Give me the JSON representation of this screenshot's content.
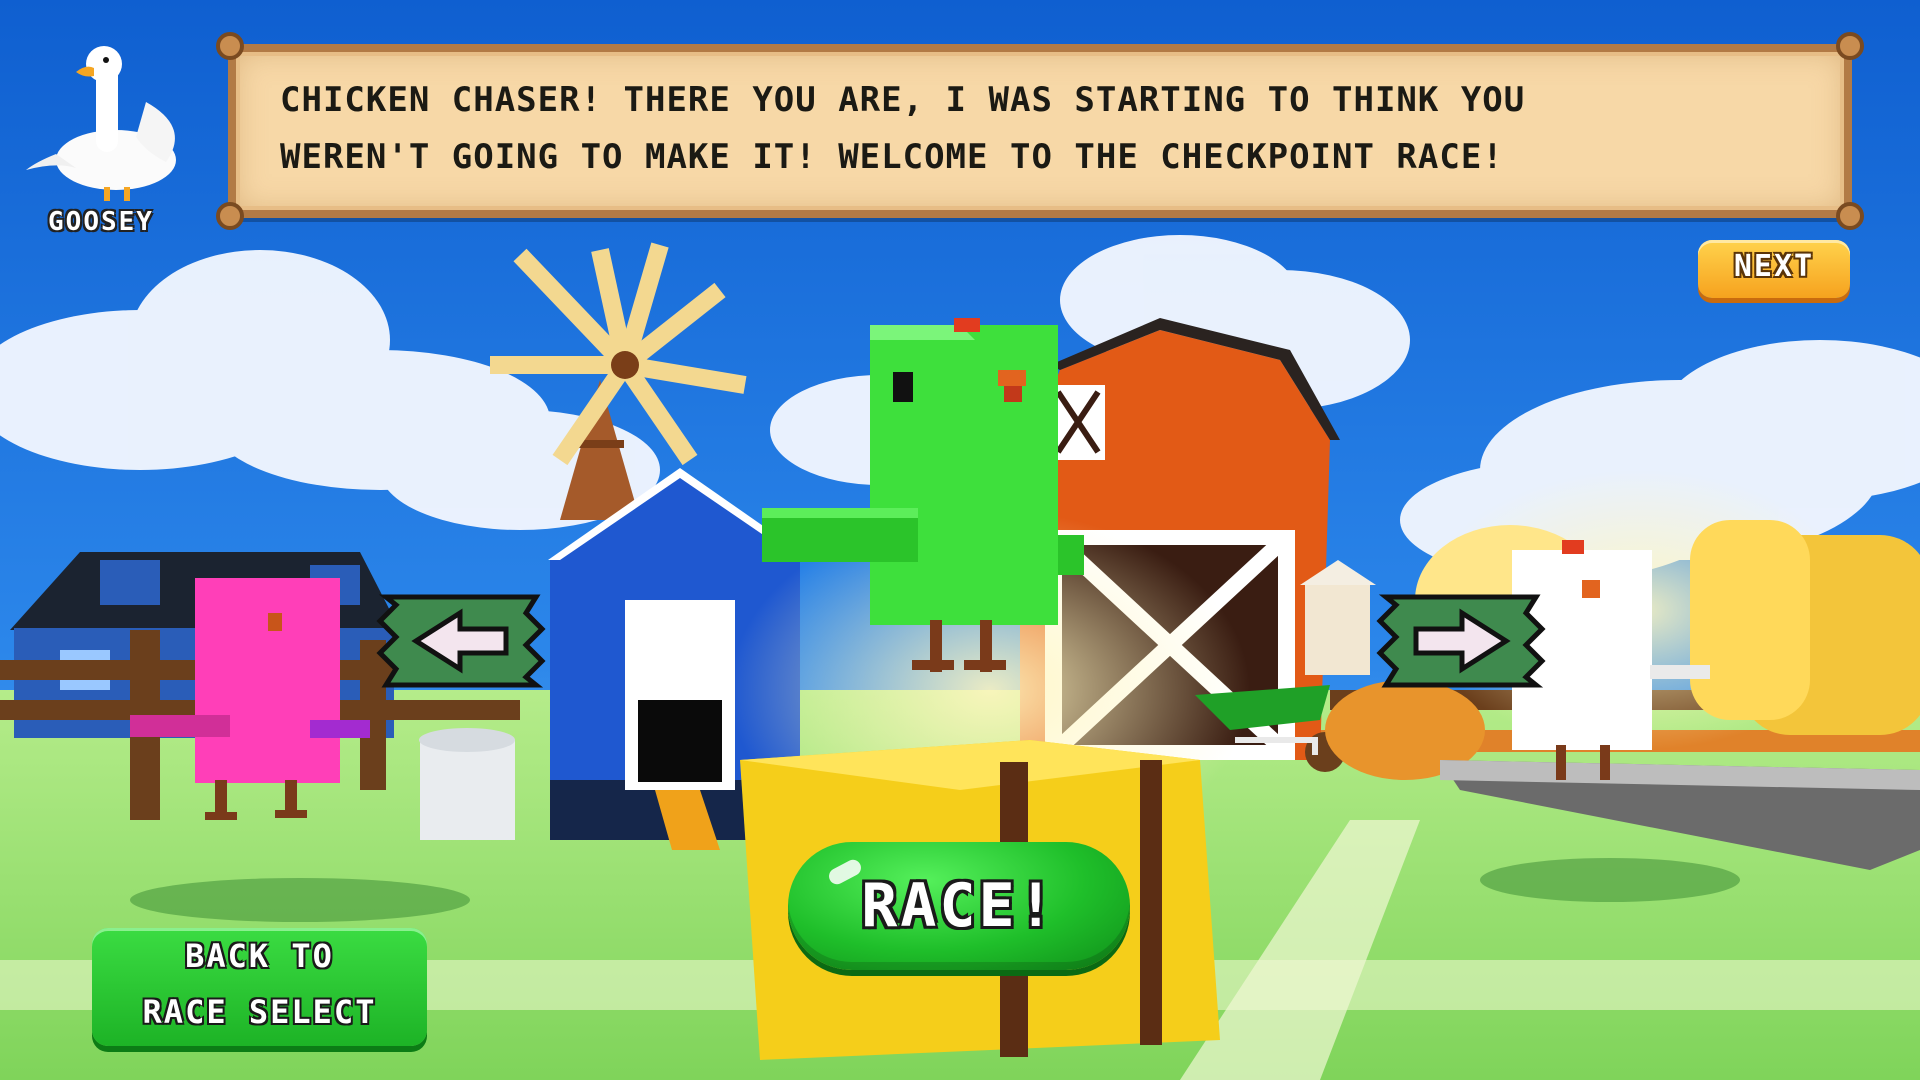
{
  "speaker": {
    "name": "GOOSEY",
    "icon": "goose-portrait-icon"
  },
  "dialog": {
    "lines": [
      "CHICKEN CHASER! THERE YOU ARE, I WAS STARTING TO THINK YOU",
      "WEREN'T GOING TO MAKE IT! WELCOME TO THE CHECKPOINT RACE!"
    ]
  },
  "buttons": {
    "next": "NEXT",
    "race": "RACE!",
    "back_line1": "BACK TO",
    "back_line2": "RACE SELECT",
    "prev_character_icon": "arrow-left-icon",
    "next_character_icon": "arrow-right-icon"
  },
  "colors": {
    "sky": "#2a7be0",
    "grass": "#8fdc66",
    "dialog_bg": "#f7d8a7",
    "dialog_border": "#b27a45",
    "next_button": "#f6a21e",
    "race_button": "#1fbf2a",
    "back_button": "#1db326",
    "arrow_sign": "#3f8a4e",
    "selected_chicken": "#3ee03c",
    "left_chicken": "#ff3fb8",
    "right_chicken": "#ffffff"
  }
}
